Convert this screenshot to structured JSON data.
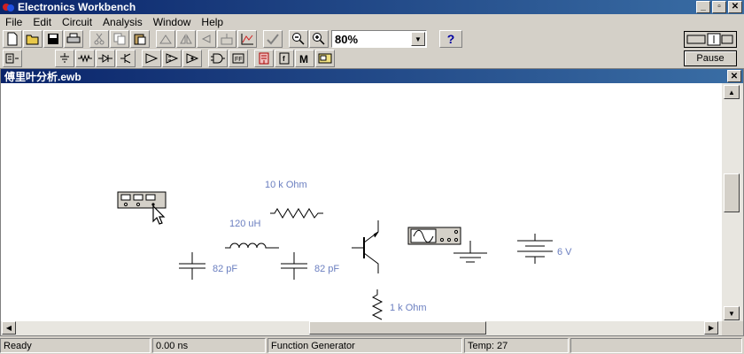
{
  "window": {
    "title": "Electronics Workbench"
  },
  "menu": [
    "File",
    "Edit",
    "Circuit",
    "Analysis",
    "Window",
    "Help"
  ],
  "toolbar": {
    "zoom_value": "80%",
    "help_label": "?"
  },
  "controls": {
    "pause_label": "Pause"
  },
  "document": {
    "title": "傅里叶分析.ewb"
  },
  "components": {
    "r1_label": "10 k Ohm",
    "l1_label": "120 uH",
    "c1_label": "82 pF",
    "c2_label": "82 pF",
    "r2_label": "1 k Ohm",
    "battery_label": "6 V"
  },
  "status": {
    "state": "Ready",
    "time": "0.00 ns",
    "selection": "Function Generator",
    "temp": "Temp:  27"
  }
}
